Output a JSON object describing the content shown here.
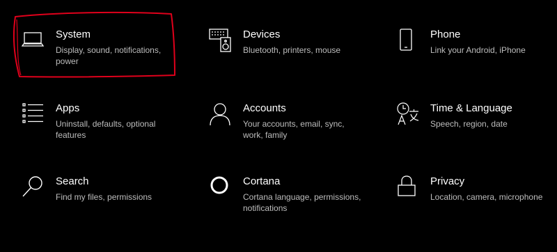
{
  "window": {
    "title": ""
  },
  "accent": {
    "annotation_color": "#e0001b",
    "text": "#ffffff",
    "subtext": "#bdbdbd",
    "background": "#000000"
  },
  "tiles": [
    {
      "title": "System",
      "description": "Display, sound, notifications, power",
      "icon": "laptop-icon"
    },
    {
      "title": "Devices",
      "description": "Bluetooth, printers, mouse",
      "icon": "keyboard-speaker-icon"
    },
    {
      "title": "Phone",
      "description": "Link your Android, iPhone",
      "icon": "phone-icon"
    },
    {
      "title": "Apps",
      "description": "Uninstall, defaults, optional features",
      "icon": "apps-list-icon"
    },
    {
      "title": "Accounts",
      "description": "Your accounts, email, sync, work, family",
      "icon": "person-icon"
    },
    {
      "title": "Time & Language",
      "description": "Speech, region, date",
      "icon": "time-language-icon"
    },
    {
      "title": "Search",
      "description": "Find my files, permissions",
      "icon": "search-icon"
    },
    {
      "title": "Cortana",
      "description": "Cortana language, permissions, notifications",
      "icon": "cortana-icon"
    },
    {
      "title": "Privacy",
      "description": "Location, camera, microphone",
      "icon": "lock-icon"
    }
  ]
}
